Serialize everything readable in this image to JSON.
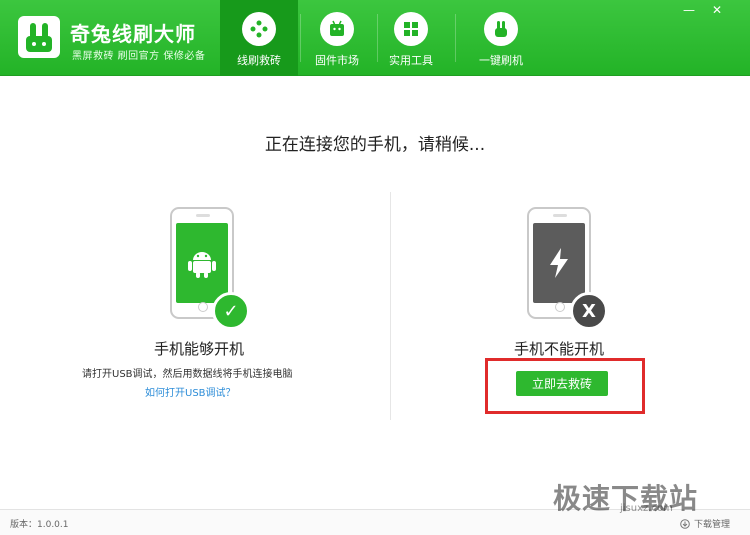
{
  "app": {
    "title": "奇兔线刷大师",
    "subtitle": "黑屏救砖 刷回官方 保修必备"
  },
  "nav": {
    "tabs": [
      {
        "label": "线刷救砖",
        "icon": "rescue-icon",
        "active": true
      },
      {
        "label": "固件市场",
        "icon": "android-store-icon",
        "active": false
      },
      {
        "label": "实用工具",
        "icon": "tools-grid-icon",
        "active": false
      },
      {
        "label": "一键刷机",
        "icon": "one-click-flash-icon",
        "active": false
      }
    ]
  },
  "window_controls": {
    "minimize": "—",
    "close": "✕"
  },
  "main": {
    "status": "正在连接您的手机，请稍候...",
    "left_option": {
      "title": "手机能够开机",
      "hint": "请打开USB调试，然后用数据线将手机连接电脑",
      "link": "如何打开USB调试？",
      "badge": "✓"
    },
    "right_option": {
      "title": "手机不能开机",
      "button": "立即去救砖",
      "badge": "X"
    }
  },
  "footer": {
    "version": "版本：1.0.0.1",
    "download_manager": "下载管理"
  },
  "watermark": {
    "text": "极速下载站",
    "url": "jisuxz.com"
  },
  "colors": {
    "brand_green": "#2eb82f",
    "active_tab": "#179a1b",
    "highlight_red": "#e02b2b",
    "link_blue": "#2d8dd8"
  }
}
